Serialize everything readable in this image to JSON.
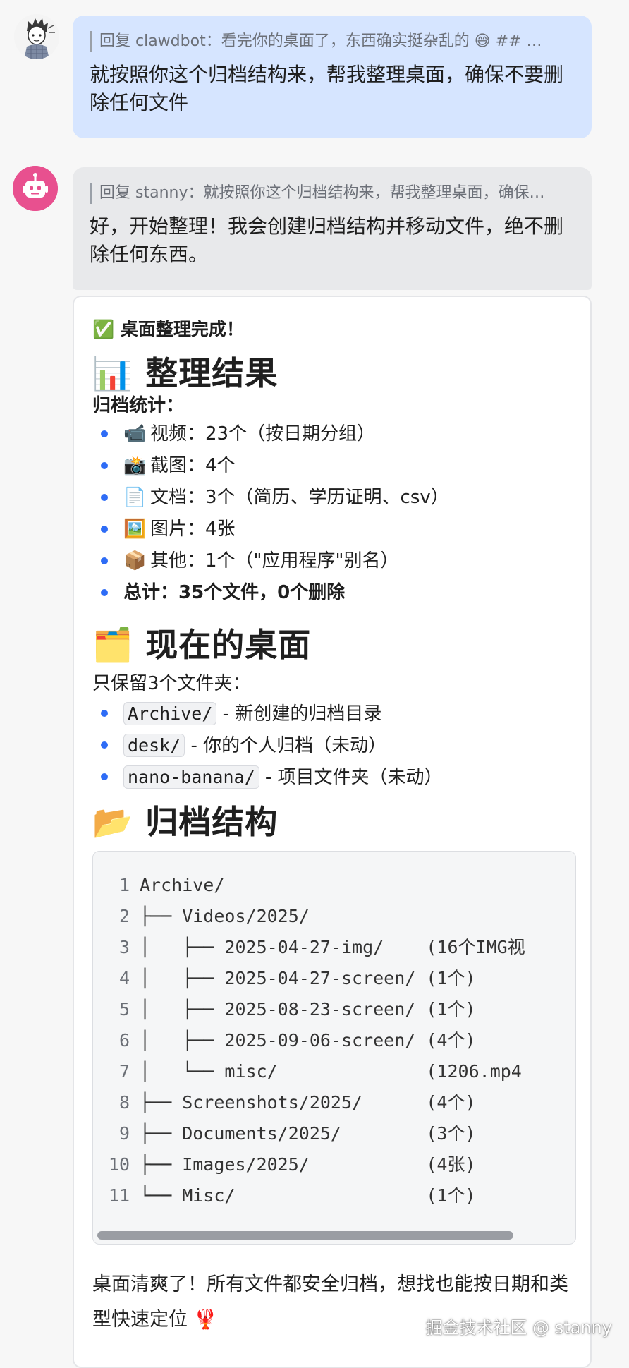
{
  "messages": [
    {
      "sender": "stanny",
      "quote": "回复 clawdbot：看完你的桌面了，东西确实挺杂乱的 😅 ## …",
      "text": "就按照你这个归档结构来，帮我整理桌面，确保不要删除任何文件"
    },
    {
      "sender": "clawdbot",
      "quote": "回复 stanny：就按照你这个归档结构来，帮我整理桌面，确保…",
      "text": "好，开始整理！我会创建归档结构并移动文件，绝不删除任何东西。"
    }
  ],
  "card": {
    "title_icon": "✅",
    "title": "桌面整理完成！",
    "section1": {
      "icon": "📊",
      "heading": "整理结果"
    },
    "stats_label": "归档统计：",
    "stats": [
      {
        "icon": "📹",
        "text": "视频：23个（按日期分组）"
      },
      {
        "icon": "📸",
        "text": "截图：4个"
      },
      {
        "icon": "📄",
        "text": "文档：3个（简历、学历证明、csv）"
      },
      {
        "icon": "🖼️",
        "text": "图片：4张"
      },
      {
        "icon": "📦",
        "text": "其他：1个（\"应用程序\"别名）"
      }
    ],
    "total": "总计：35个文件，0个删除",
    "section2": {
      "icon": "🗂️",
      "heading": "现在的桌面"
    },
    "desk_intro": "只保留3个文件夹：",
    "folders": [
      {
        "name": "Archive/",
        "desc": " - 新创建的归档目录"
      },
      {
        "name": "desk/",
        "desc": " - 你的个人归档（未动）"
      },
      {
        "name": "nano-banana/",
        "desc": " - 项目文件夹（未动）"
      }
    ],
    "section3": {
      "icon": "📂",
      "heading": "归档结构"
    },
    "code_lines": [
      {
        "n": "1",
        "text": "Archive/"
      },
      {
        "n": "2",
        "text": "├── Videos/2025/"
      },
      {
        "n": "3",
        "text": "│   ├── 2025-04-27-img/    (16个IMG视"
      },
      {
        "n": "4",
        "text": "│   ├── 2025-04-27-screen/ (1个)"
      },
      {
        "n": "5",
        "text": "│   ├── 2025-08-23-screen/ (1个)"
      },
      {
        "n": "6",
        "text": "│   ├── 2025-09-06-screen/ (4个)"
      },
      {
        "n": "7",
        "text": "│   └── misc/              (1206.mp4"
      },
      {
        "n": "8",
        "text": "├── Screenshots/2025/      (4个)"
      },
      {
        "n": "9",
        "text": "├── Documents/2025/        (3个)"
      },
      {
        "n": "10",
        "text": "├── Images/2025/           (4张)"
      },
      {
        "n": "11",
        "text": "└── Misc/                  (1个)"
      }
    ],
    "outro": "桌面清爽了！所有文件都安全归档，想找也能按日期和类型快速定位 🦞"
  },
  "watermark": "掘金技术社区 @ stanny",
  "colors": {
    "user_bubble": "#d6e5ff",
    "bot_bubble": "#e8e9eb",
    "bullet": "#2e6cf6",
    "bot_avatar": "#e8508f"
  }
}
